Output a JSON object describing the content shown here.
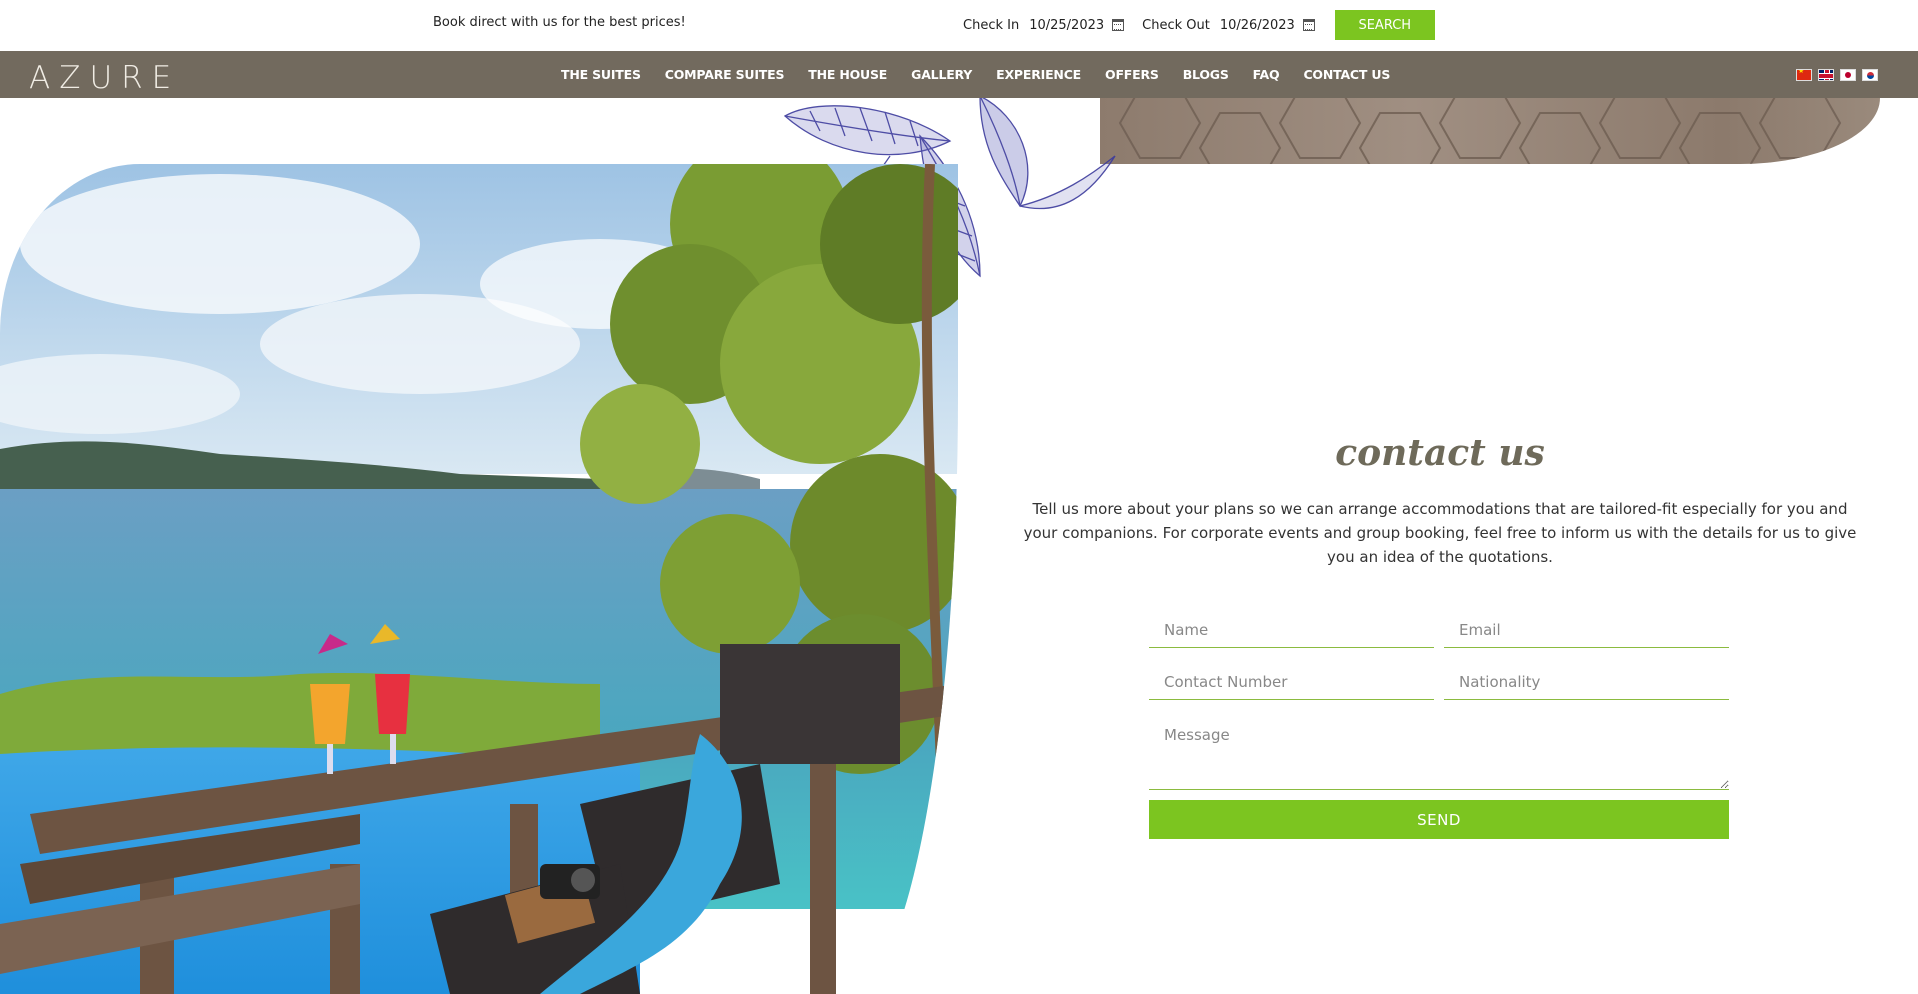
{
  "topbar": {
    "promo_text": "Book direct with us for the best prices!",
    "check_in_label": "Check In",
    "check_in_date": "10/25/2023",
    "check_out_label": "Check Out",
    "check_out_date": "10/26/2023",
    "search_label": "SEARCH",
    "calendar_icon": "calendar-icon"
  },
  "nav": {
    "logo": "AZURE",
    "items": [
      {
        "label": "THE SUITES"
      },
      {
        "label": "COMPARE SUITES"
      },
      {
        "label": "THE HOUSE"
      },
      {
        "label": "GALLERY"
      },
      {
        "label": "EXPERIENCE"
      },
      {
        "label": "OFFERS"
      },
      {
        "label": "BLOGS"
      },
      {
        "label": "FAQ"
      },
      {
        "label": "CONTACT US"
      }
    ],
    "languages": [
      "chinese-flag-icon",
      "uk-flag-icon",
      "japan-flag-icon",
      "korea-flag-icon"
    ]
  },
  "contact": {
    "title": "contact us",
    "intro": "Tell us more about your plans so we can arrange accommodations that are tailored-fit especially for you and your companions. For corporate events and group booking, feel free to inform us with the details for us to give you an idea of the quotations.",
    "form": {
      "name_placeholder": "Name",
      "email_placeholder": "Email",
      "contact_placeholder": "Contact Number",
      "nationality_placeholder": "Nationality",
      "message_placeholder": "Message",
      "send_label": "SEND"
    }
  },
  "colors": {
    "accent_green": "#7cc520",
    "nav_bg": "#726a5e",
    "title_color": "#6e6a5a"
  }
}
